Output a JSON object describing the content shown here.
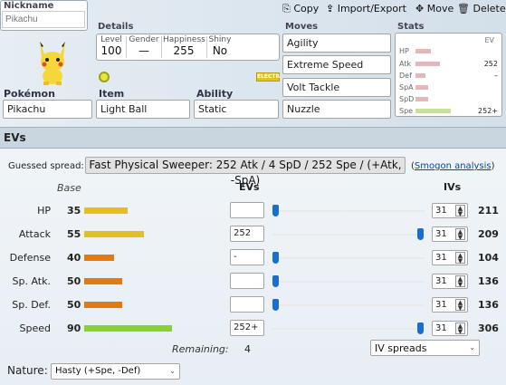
{
  "toolbar": {
    "copy_label": "Copy",
    "import_export_label": "Import/Export",
    "move_label": "Move",
    "delete_label": "Delete"
  },
  "nickname": {
    "label": "Nickname",
    "placeholder": "Pikachu"
  },
  "details": {
    "label": "Details",
    "level_label": "Level",
    "level": "100",
    "gender_label": "Gender",
    "gender": "—",
    "happiness_label": "Happiness",
    "happiness": "255",
    "shiny_label": "Shiny",
    "shiny": "No"
  },
  "pokemon": {
    "label": "Pokémon",
    "value": "Pikachu",
    "type_badge": "ELECTR"
  },
  "item": {
    "label": "Item",
    "value": "Light Ball"
  },
  "ability": {
    "label": "Ability",
    "value": "Static"
  },
  "moves": {
    "label": "Moves",
    "list": [
      "Agility",
      "Extreme Speed",
      "Volt Tackle",
      "Nuzzle"
    ]
  },
  "stats_summary": {
    "label": "Stats",
    "ev_header": "EV",
    "rows": [
      {
        "name": "HP",
        "ev": ""
      },
      {
        "name": "Atk",
        "ev": "252"
      },
      {
        "name": "Def",
        "ev": "–"
      },
      {
        "name": "SpA",
        "ev": ""
      },
      {
        "name": "SpD",
        "ev": ""
      },
      {
        "name": "Spe",
        "ev": "252+"
      }
    ]
  },
  "ev_section": {
    "title": "EVs",
    "guessed_label": "Guessed spread:",
    "guessed_value": "Fast Physical Sweeper: 252 Atk / 4 SpD / 252 Spe / (+Atk, -SpA)",
    "smogon_link": "Smogon analysis",
    "base_header": "Base",
    "evs_header": "EVs",
    "ivs_header": "IVs",
    "stats": [
      {
        "name": "HP",
        "base": "35",
        "ev": "",
        "iv": "31",
        "total": "211"
      },
      {
        "name": "Attack",
        "base": "55",
        "ev": "252",
        "iv": "31",
        "total": "209"
      },
      {
        "name": "Defense",
        "base": "40",
        "ev": "-",
        "iv": "31",
        "total": "104"
      },
      {
        "name": "Sp. Atk.",
        "base": "50",
        "ev": "",
        "iv": "31",
        "total": "136"
      },
      {
        "name": "Sp. Def.",
        "base": "50",
        "ev": "",
        "iv": "31",
        "total": "136"
      },
      {
        "name": "Speed",
        "base": "90",
        "ev": "252+",
        "iv": "31",
        "total": "306"
      }
    ],
    "remaining_label": "Remaining:",
    "remaining_value": "4",
    "iv_spreads": "IV spreads",
    "nature_label": "Nature:",
    "nature_value": "Hasty (+Spe, -Def)"
  },
  "colors": {
    "bar_yellow": "#e0c11f",
    "bar_orange": "#e07b14",
    "bar_green": "#8bd12b",
    "slider_thumb": "#1a6ecf",
    "link": "#0645ad"
  }
}
